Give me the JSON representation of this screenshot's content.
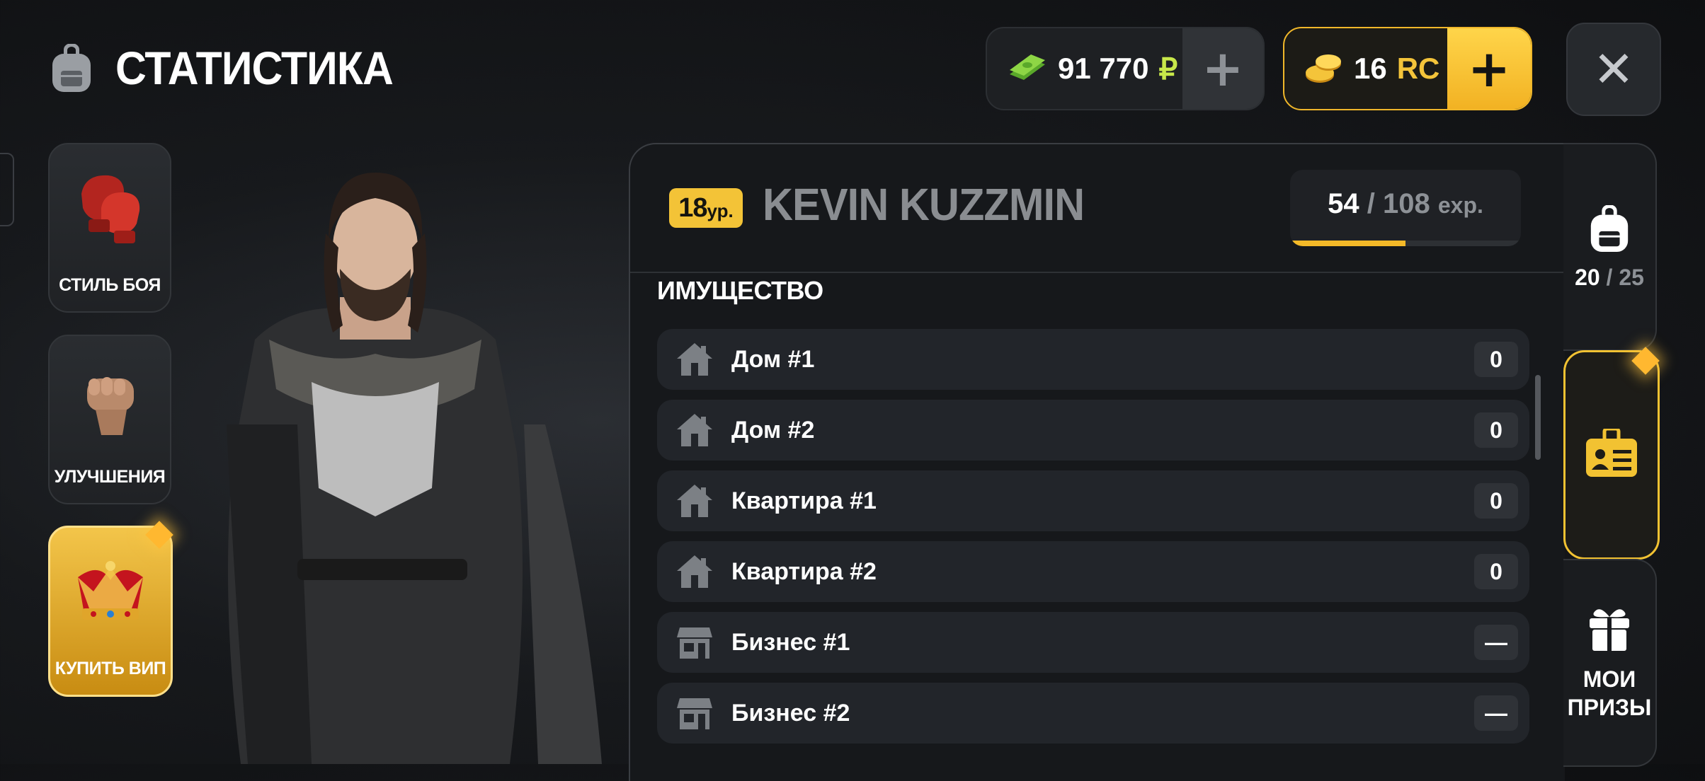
{
  "header": {
    "title": "СТАТИСТИКА",
    "money": {
      "amount": "91 770",
      "currency": "₽"
    },
    "coins": {
      "amount": "16",
      "currency": "RC"
    }
  },
  "left_menu": [
    {
      "label": "СТИЛЬ БОЯ",
      "icon": "boxing-gloves-icon"
    },
    {
      "label": "УЛУЧШЕНИЯ",
      "icon": "fist-icon"
    },
    {
      "label": "КУПИТЬ ВИП",
      "icon": "crown-icon"
    }
  ],
  "player": {
    "level": "18",
    "level_unit": "ур.",
    "name": "KEVIN KUZZMIN",
    "exp_current": "54",
    "exp_total": "108",
    "exp_unit": "exp.",
    "exp_progress": 0.5
  },
  "property": {
    "title": "ИМУЩЕСТВО",
    "items": [
      {
        "label": "Дом #1",
        "value": "0",
        "icon": "house-icon"
      },
      {
        "label": "Дом #2",
        "value": "0",
        "icon": "house-icon"
      },
      {
        "label": "Квартира #1",
        "value": "0",
        "icon": "house-icon"
      },
      {
        "label": "Квартира #2",
        "value": "0",
        "icon": "house-icon"
      },
      {
        "label": "Бизнес #1",
        "value": "—",
        "icon": "shop-icon"
      },
      {
        "label": "Бизнес #2",
        "value": "—",
        "icon": "shop-icon"
      }
    ]
  },
  "right_tabs": {
    "inventory": {
      "current": "20",
      "max": "25",
      "icon": "backpack-icon"
    },
    "id_card": {
      "icon": "id-card-icon"
    },
    "prizes": {
      "label_line1": "МОИ",
      "label_line2": "ПРИЗЫ",
      "icon": "gift-icon"
    }
  },
  "colors": {
    "accent": "#f3c337",
    "money": "#c8e84a"
  }
}
